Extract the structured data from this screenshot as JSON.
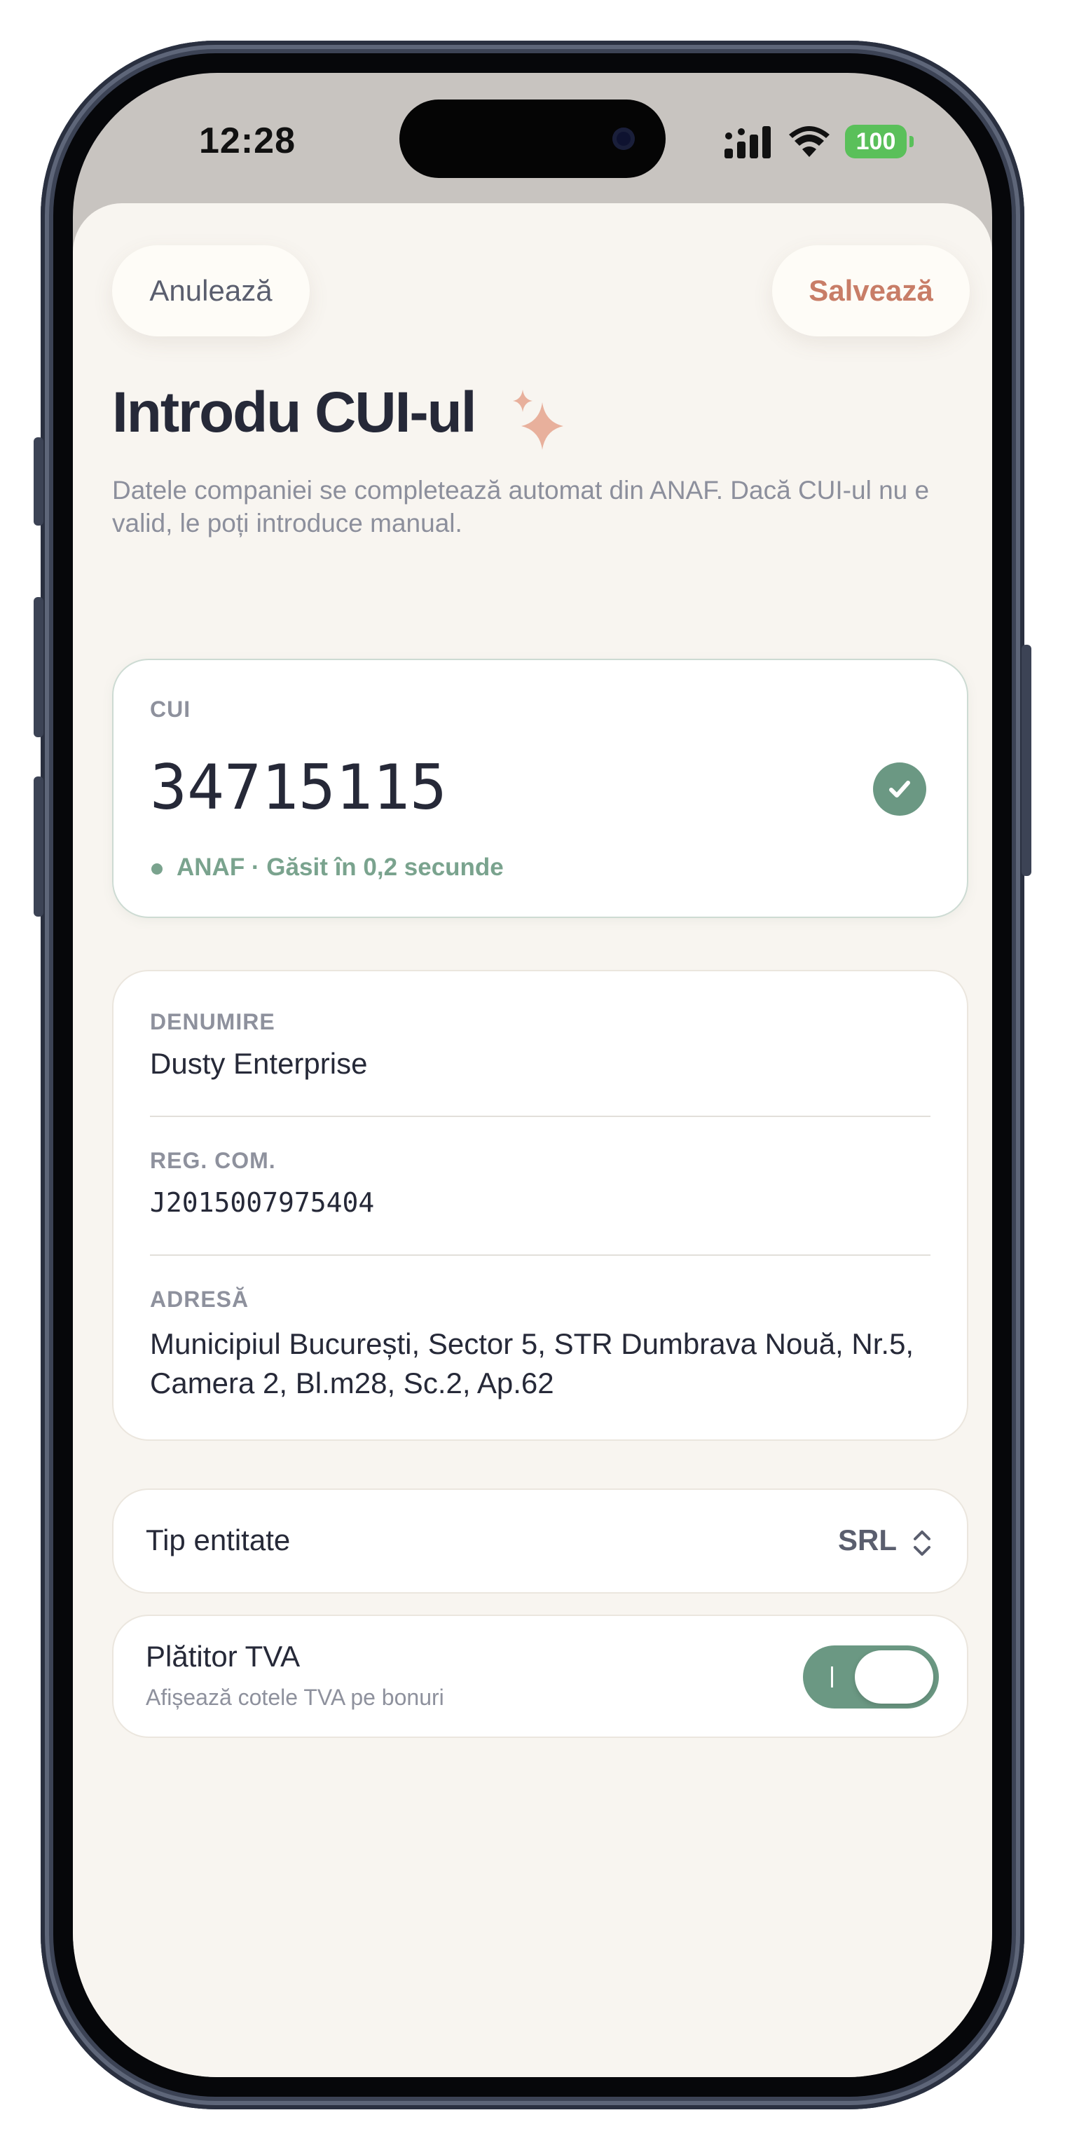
{
  "status_bar": {
    "time": "12:28",
    "battery": "100"
  },
  "header": {
    "cancel_label": "Anulează",
    "save_label": "Salvează"
  },
  "title": "Introdu CUI-ul",
  "subtitle": "Datele companiei se completează automat din ANAF. Dacă CUI-ul nu e valid, le poți introduce manual.",
  "cui_card": {
    "label": "CUI",
    "value": "34715115",
    "status": "ANAF · Găsit în 0,2 secunde"
  },
  "details": {
    "name_label": "DENUMIRE",
    "name_value": "Dusty Enterprise",
    "reg_label": "REG. COM.",
    "reg_value": "J2015007975404",
    "address_label": "ADRESĂ",
    "address_value": "Municipiul București, Sector 5, STR Dumbrava Nouă, Nr.5, Camera 2, Bl.m28, Sc.2, Ap.62"
  },
  "entity": {
    "label": "Tip entitate",
    "value": "SRL"
  },
  "vat": {
    "title": "Plătitor TVA",
    "subtitle": "Afișează cotele TVA pe bonuri",
    "enabled": true
  },
  "colors": {
    "accent_green": "#6b9883",
    "save_orange": "#c87d67",
    "sheet_bg": "#f8f5f0",
    "battery_green": "#5ac05a"
  },
  "icons": {
    "sparkle": "sparkle-icon",
    "check": "check-icon",
    "updown": "chevron-up-down-icon",
    "signal": "signal-icon",
    "wifi": "wifi-icon"
  }
}
